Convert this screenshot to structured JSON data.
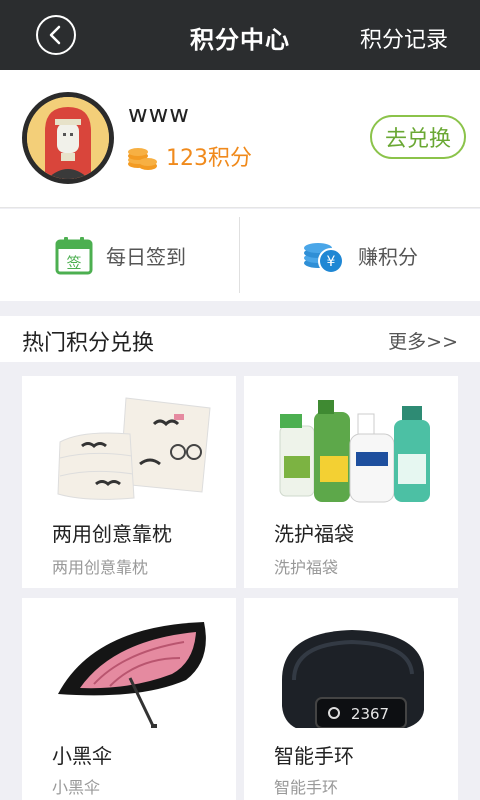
{
  "header": {
    "title": "积分中心",
    "record_link": "积分记录"
  },
  "profile": {
    "username": "www",
    "points": "123积分",
    "redeem_button": "去兑换"
  },
  "actions": {
    "checkin_label": "每日签到",
    "checkin_icon_text": "签",
    "earn_label": "赚积分"
  },
  "section": {
    "title": "热门积分兑换",
    "more": "更多>>"
  },
  "products": [
    {
      "name": "两用创意靠枕",
      "subtitle": "两用创意靠枕"
    },
    {
      "name": "洗护福袋",
      "subtitle": "洗护福袋"
    },
    {
      "name": "小黑伞",
      "subtitle": "小黑伞"
    },
    {
      "name": "智能手环",
      "subtitle": "智能手环"
    }
  ],
  "band_display": "2367",
  "colors": {
    "header_bg": "#2b2d2f",
    "points_orange": "#f08a1c",
    "redeem_green": "#8bc34a"
  }
}
